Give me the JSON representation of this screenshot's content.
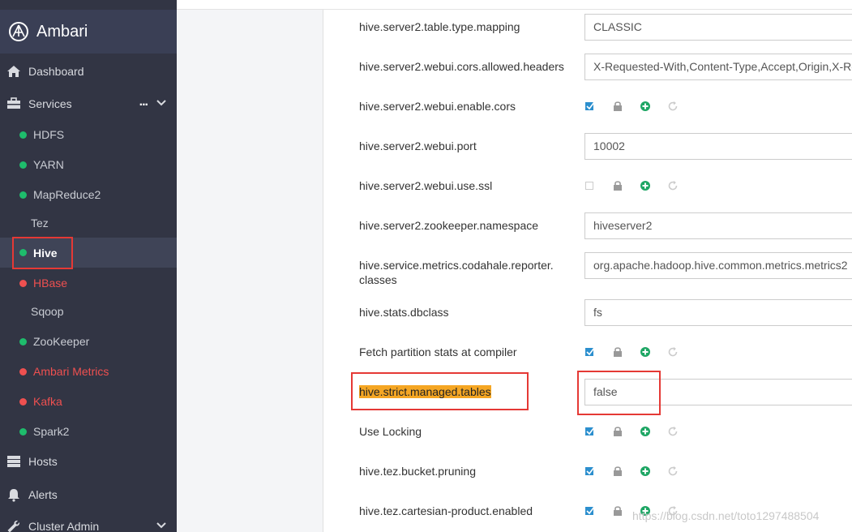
{
  "brand": {
    "name": "Ambari"
  },
  "sidebar": {
    "items": [
      {
        "label": "Dashboard",
        "icon": "home-icon"
      },
      {
        "label": "Services",
        "icon": "briefcase-icon",
        "menu": "..."
      },
      {
        "label": "Hosts",
        "icon": "server-icon"
      },
      {
        "label": "Alerts",
        "icon": "bell-icon"
      },
      {
        "label": "Cluster Admin",
        "icon": "wrench-icon"
      }
    ],
    "services": [
      {
        "label": "HDFS",
        "status": "green"
      },
      {
        "label": "YARN",
        "status": "green"
      },
      {
        "label": "MapReduce2",
        "status": "green"
      },
      {
        "label": "Tez",
        "status": "none"
      },
      {
        "label": "Hive",
        "status": "green",
        "active": true
      },
      {
        "label": "HBase",
        "status": "red"
      },
      {
        "label": "Sqoop",
        "status": "none"
      },
      {
        "label": "ZooKeeper",
        "status": "green"
      },
      {
        "label": "Ambari Metrics",
        "status": "red"
      },
      {
        "label": "Kafka",
        "status": "red"
      },
      {
        "label": "Spark2",
        "status": "green"
      }
    ]
  },
  "properties": [
    {
      "name": "hive.server2.table.type.mapping",
      "value": "CLASSIC"
    },
    {
      "name": "hive.server2.webui.cors.allowed.headers",
      "value": "X-Requested-With,Content-Type,Accept,Origin,X-Req"
    },
    {
      "name": "hive.server2.webui.enable.cors",
      "checkbox": true,
      "checked": true
    },
    {
      "name": "hive.server2.webui.port",
      "value": "10002"
    },
    {
      "name": "hive.server2.webui.use.ssl",
      "checkbox": true,
      "checked": false
    },
    {
      "name": "hive.server2.zookeeper.namespace",
      "value": "hiveserver2"
    },
    {
      "name": "hive.service.metrics.codahale.reporter.\nclasses",
      "value": "org.apache.hadoop.hive.common.metrics.metrics2"
    },
    {
      "name": "hive.stats.dbclass",
      "value": "fs"
    },
    {
      "name": "Fetch partition stats at compiler",
      "checkbox": true,
      "checked": true
    },
    {
      "name": "hive.strict.managed.tables",
      "value": "false",
      "highlight": true
    },
    {
      "name": "Use Locking",
      "checkbox": true,
      "checked": true
    },
    {
      "name": "hive.tez.bucket.pruning",
      "checkbox": true,
      "checked": true
    },
    {
      "name": "hive.tez.cartesian-product.enabled",
      "checkbox": true,
      "checked": true
    }
  ],
  "watermark": "https://blog.csdn.net/toto1297488504",
  "colors": {
    "sidebar": "#323544",
    "header": "#3a3f55",
    "green": "#1ebc6c",
    "red": "#ef5050",
    "highlight_box": "#e53935",
    "highlight_text": "#f5a623"
  }
}
